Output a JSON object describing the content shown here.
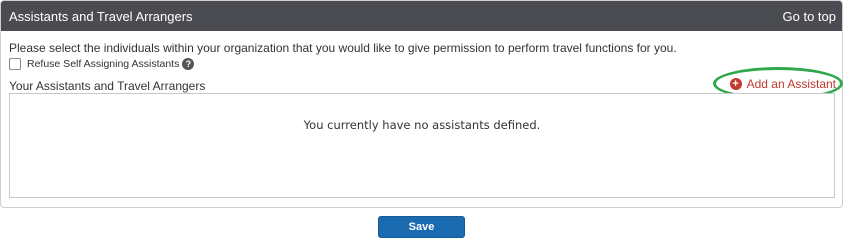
{
  "header": {
    "title": "Assistants and Travel Arrangers",
    "go_to_top": "Go to top"
  },
  "intro_text": "Please select the individuals within your organization that you would like to give permission to perform travel functions for you.",
  "refuse_checkbox": {
    "label": "Refuse Self Assigning Assistants",
    "checked": false,
    "help_glyph": "?"
  },
  "assistants_section": {
    "label": "Your Assistants and Travel Arrangers",
    "add_link": "Add an Assistant",
    "add_icon": "plus-circle-icon",
    "empty_message": "You currently have no assistants defined."
  },
  "save_button": "Save",
  "colors": {
    "header_bg": "#4a4c52",
    "link_red": "#c0392b",
    "highlight_green": "#2ea84a",
    "save_blue": "#1a6ab0"
  }
}
